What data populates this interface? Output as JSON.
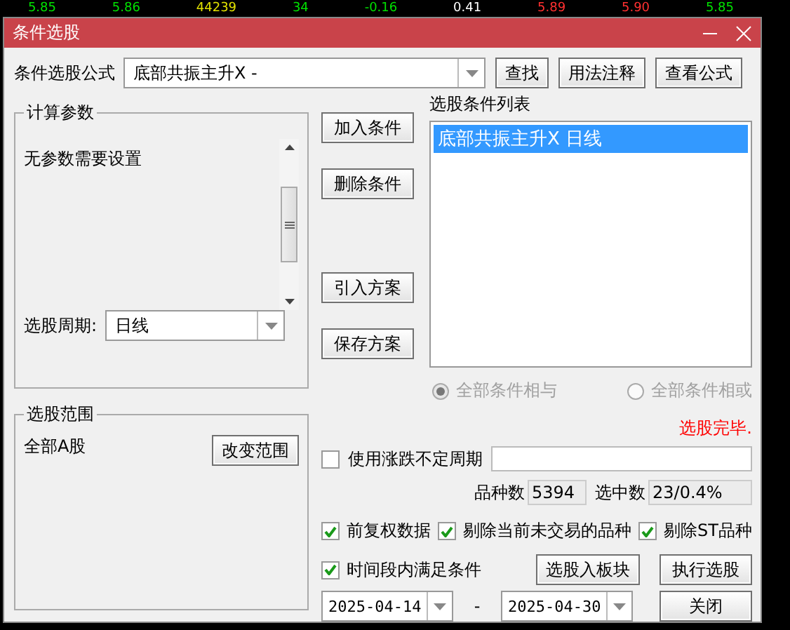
{
  "ticker": [
    {
      "text": "5.85",
      "color": "#00e000"
    },
    {
      "text": "5.86",
      "color": "#00e000"
    },
    {
      "text": "44239",
      "color": "#e0e000"
    },
    {
      "text": "34",
      "color": "#00e000"
    },
    {
      "text": "-0.16",
      "color": "#00e000"
    },
    {
      "text": "0.41",
      "color": "#ffffff"
    },
    {
      "text": "5.89",
      "color": "#ff3030"
    },
    {
      "text": "5.90",
      "color": "#ff3030"
    },
    {
      "text": "5.85",
      "color": "#00e000"
    }
  ],
  "window": {
    "title": "条件选股"
  },
  "formula": {
    "label": "条件选股公式",
    "value": "底部共振主升X -",
    "buttons": [
      "查找",
      "用法注释",
      "查看公式"
    ]
  },
  "params_group": {
    "title": "计算参数",
    "message": "无参数需要设置",
    "period_label": "选股周期:",
    "period_value": "日线"
  },
  "range_group": {
    "title": "选股范围",
    "value": "全部A股",
    "button": "改变范围"
  },
  "side_buttons": [
    "加入条件",
    "删除条件",
    "引入方案",
    "保存方案"
  ],
  "conditions": {
    "label": "选股条件列表",
    "items": [
      {
        "text": "底部共振主升X  日线",
        "selected": true
      }
    ]
  },
  "logic_options": [
    {
      "label": "全部条件相与",
      "selected": true,
      "disabled": true
    },
    {
      "label": "全部条件相或",
      "selected": false,
      "disabled": true
    }
  ],
  "status_text": "选股完毕.",
  "variable_period": {
    "label": "使用涨跌不定周期",
    "checked": false
  },
  "counts": [
    {
      "label": "品种数",
      "value": "5394"
    },
    {
      "label": "选中数",
      "value": "23/0.4%"
    }
  ],
  "options": [
    {
      "label": "前复权数据",
      "checked": true
    },
    {
      "label": "剔除当前未交易的品种",
      "checked": true
    },
    {
      "label": "剔除ST品种",
      "checked": true
    }
  ],
  "time_range": {
    "label": "时间段内满足条件",
    "checked": true,
    "start": "2025-04-14",
    "separator": "-",
    "end": "2025-04-30"
  },
  "action_buttons": [
    "选股入板块",
    "执行选股"
  ],
  "close_button": "关闭"
}
